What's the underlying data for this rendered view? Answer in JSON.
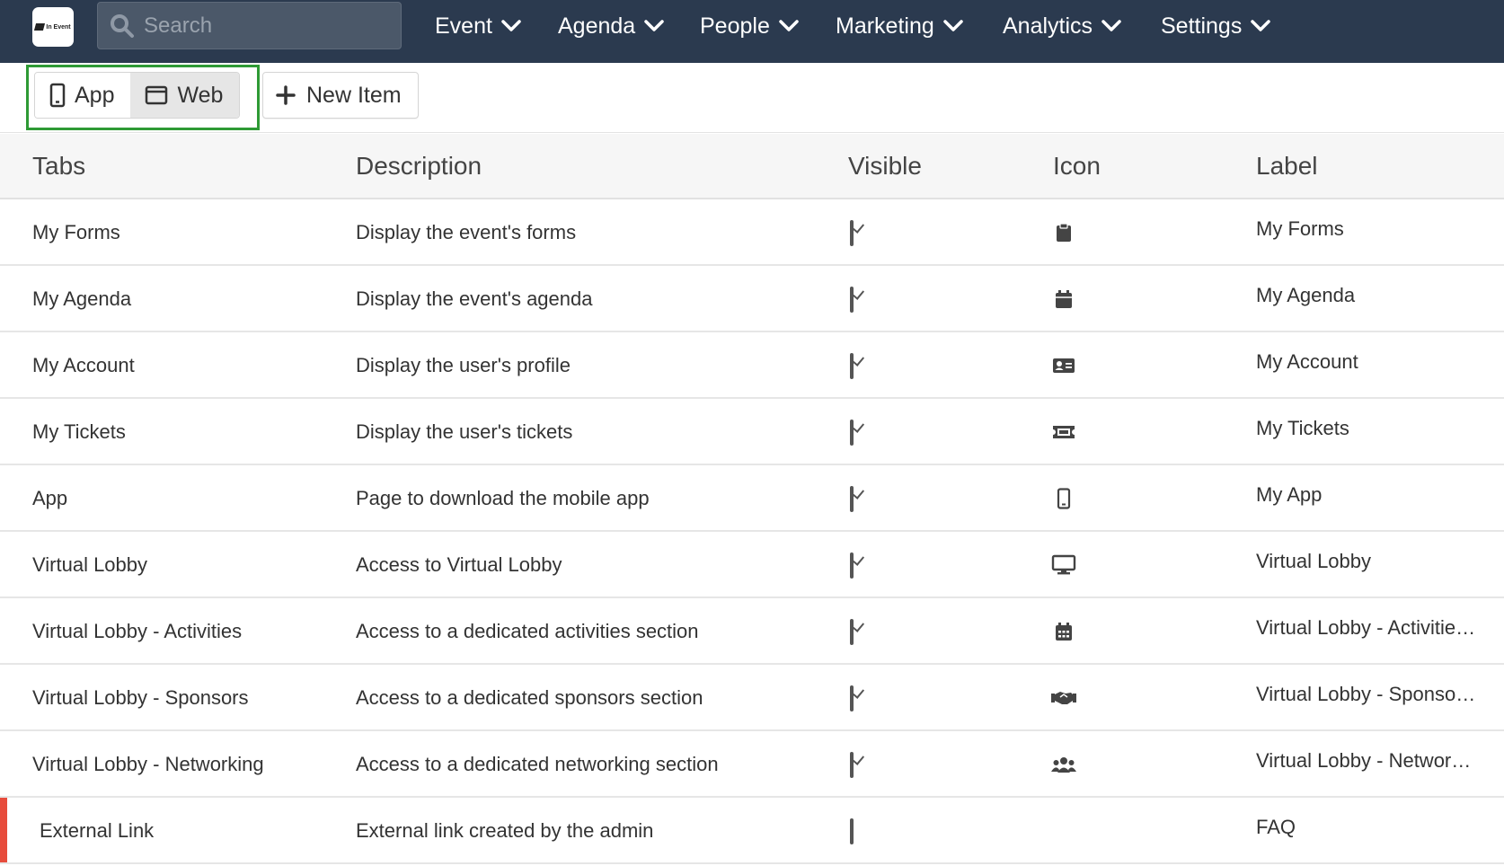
{
  "nav": {
    "logo_text": "In Event",
    "search_placeholder": "Search",
    "items": [
      {
        "label": "Event"
      },
      {
        "label": "Agenda"
      },
      {
        "label": "People"
      },
      {
        "label": "Marketing"
      },
      {
        "label": "Analytics"
      },
      {
        "label": "Settings"
      }
    ]
  },
  "toolbar": {
    "app_label": "App",
    "web_label": "Web",
    "new_item_label": "New Item",
    "highlight_color": "#2e9a35"
  },
  "table": {
    "headers": {
      "tabs": "Tabs",
      "description": "Description",
      "visible": "Visible",
      "icon": "Icon",
      "label": "Label"
    },
    "rows": [
      {
        "tab": "My Forms",
        "description": "Display the event's forms",
        "visible": true,
        "icon": "clipboard-icon",
        "label": "My Forms"
      },
      {
        "tab": "My Agenda",
        "description": "Display the event's agenda",
        "visible": true,
        "icon": "calendar-icon",
        "label": "My Agenda"
      },
      {
        "tab": "My Account",
        "description": "Display the user's profile",
        "visible": true,
        "icon": "id-card-icon",
        "label": "My Account"
      },
      {
        "tab": "My Tickets",
        "description": "Display the user's tickets",
        "visible": true,
        "icon": "ticket-icon",
        "label": "My Tickets"
      },
      {
        "tab": "App",
        "description": "Page to download the mobile app",
        "visible": true,
        "icon": "mobile-icon",
        "label": "My App"
      },
      {
        "tab": "Virtual Lobby",
        "description": "Access to Virtual Lobby",
        "visible": true,
        "icon": "desktop-icon",
        "label": "Virtual Lobby"
      },
      {
        "tab": "Virtual Lobby - Activities",
        "description": "Access to a dedicated activities section",
        "visible": true,
        "icon": "calendar-grid-icon",
        "label": "Virtual Lobby - Activities..."
      },
      {
        "tab": "Virtual Lobby - Sponsors",
        "description": "Access to a dedicated sponsors section",
        "visible": true,
        "icon": "handshake-icon",
        "label": "Virtual Lobby - Sponsors..."
      },
      {
        "tab": "Virtual Lobby - Networking",
        "description": "Access to a dedicated networking section",
        "visible": true,
        "icon": "users-icon",
        "label": "Virtual Lobby - Networking..."
      },
      {
        "tab": "External Link",
        "description": "External link created by the admin",
        "visible": false,
        "icon": "",
        "label": "FAQ",
        "flagged": true,
        "flag_color": "#e74c3c"
      }
    ]
  },
  "colors": {
    "topbar": "#2b3a4f",
    "search_bg": "#4b5869"
  }
}
